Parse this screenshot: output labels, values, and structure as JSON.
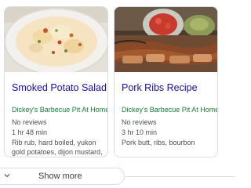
{
  "cards": [
    {
      "title": "Smoked Potato Salad",
      "source": "Dickey's Barbecue Pit At Home",
      "reviews": "No reviews",
      "time": "1 hr 48 min",
      "ingredients": "Rib rub, hard boiled, yukon gold potatoes, dijon mustard, pickle",
      "image": "potato-salad-photo"
    },
    {
      "title": "Pork Ribs Recipe",
      "source": "Dickey's Barbecue Pit At Home",
      "reviews": "No reviews",
      "time": "3 hr 10 min",
      "ingredients": "Pork butt, ribs, bourbon",
      "image": "pork-ribs-photo"
    }
  ],
  "show_more": {
    "label": "Show more",
    "icon": "chevron-down-icon"
  },
  "colors": {
    "title_link": "#1a0dab",
    "source_green": "#188038",
    "meta_gray": "#4d5156",
    "border": "#dadce0"
  }
}
